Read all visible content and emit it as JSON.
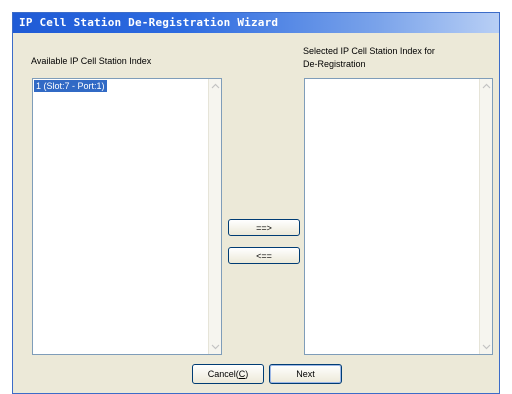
{
  "window": {
    "title": "IP Cell Station De-Registration Wizard"
  },
  "available": {
    "label": "Available IP Cell Station Index",
    "items": [
      "1 (Slot:7 - Port:1)"
    ]
  },
  "selected": {
    "label_line1": "Selected IP Cell Station Index for",
    "label_line2": "De-Registration",
    "items": []
  },
  "buttons": {
    "add_label": "==>",
    "remove_label": "<==",
    "cancel_label_prefix": "Cancel(",
    "cancel_mnemonic": "C",
    "cancel_label_suffix": ")",
    "next_label": "Next"
  },
  "icons": {
    "scroll_up": "scroll-up-icon",
    "scroll_down": "scroll-down-icon"
  },
  "colors": {
    "titlebar_start": "#1f5bd6",
    "dialog_bg": "#ece9d8",
    "selection": "#316ac5",
    "list_border": "#7f9db9"
  }
}
